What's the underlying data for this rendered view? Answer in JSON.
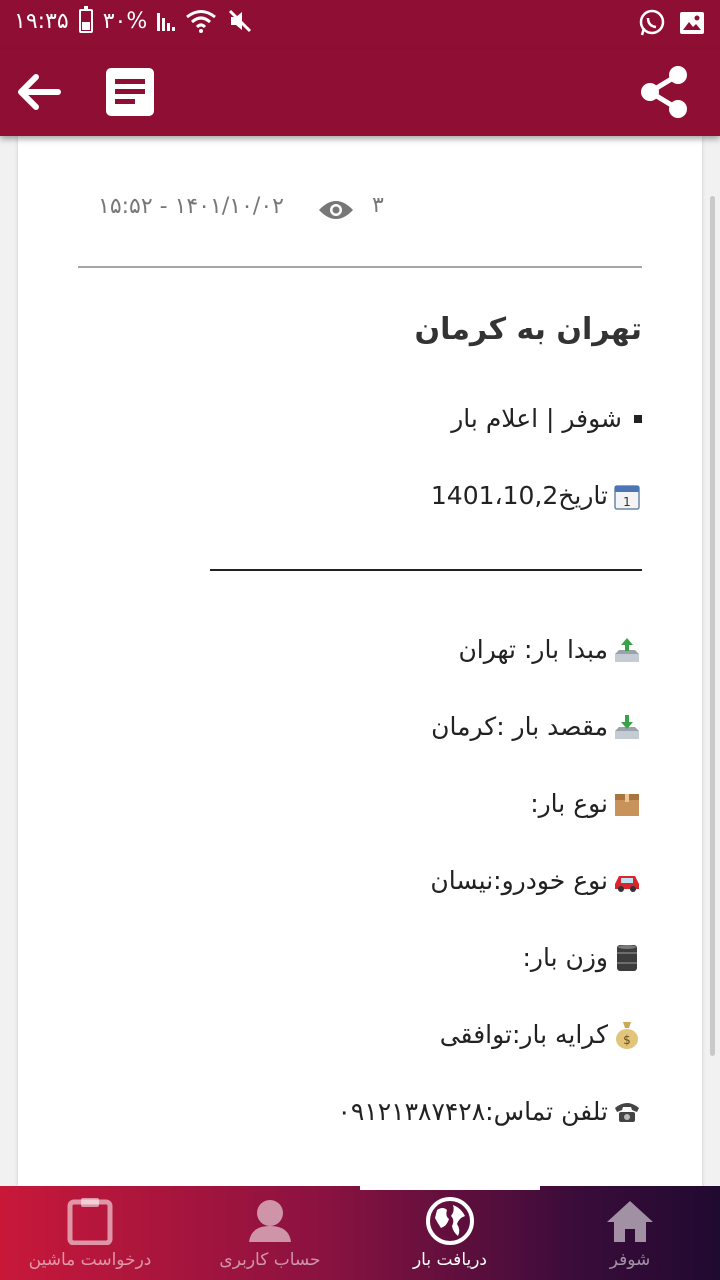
{
  "status_bar": {
    "time": "۱۹:۳۵",
    "battery": "۳۰%"
  },
  "meta": {
    "date": "۱۵:۵۲ - ۱۴۰۱/۱۰/۰۲",
    "views": "۳"
  },
  "post": {
    "title": "تهران به کرمان",
    "category": "شوفر | اعلام بار",
    "date_line": "تاریخ1401،10,2",
    "origin": "مبدا بار: تهران",
    "destination": "مقصد بار :کرمان",
    "cargo_type": "نوع بار:",
    "vehicle_type": "نوع خودرو:نیسان",
    "weight": "وزن بار:",
    "fare": "کرایه بار:توافقی",
    "phone": "تلفن تماس:۰۹۱۲۱۳۸۷۴۲۸"
  },
  "bottom_nav": [
    {
      "label": "درخواست ماشین",
      "icon": "clipboard-icon"
    },
    {
      "label": "حساب کاربری",
      "icon": "user-icon"
    },
    {
      "label": "دریافت بار",
      "icon": "globe-icon",
      "active": true
    },
    {
      "label": "شوفر",
      "icon": "home-icon"
    }
  ],
  "colors": {
    "primary": "#8f0f34",
    "nav_start": "#c8183a",
    "nav_end": "#200a30"
  }
}
